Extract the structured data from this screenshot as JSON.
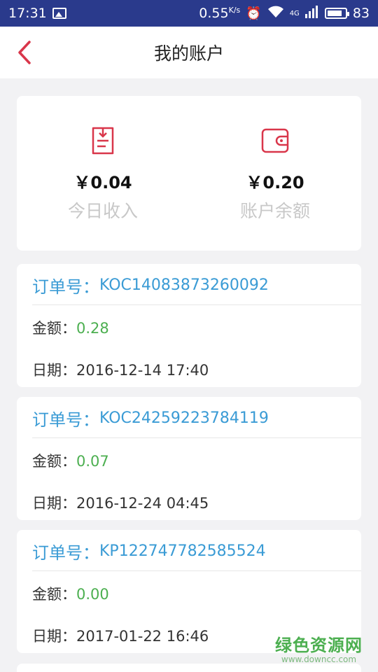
{
  "status_bar": {
    "time": "17:31",
    "speed": "0.55",
    "speed_unit": "K/s",
    "network": "4G",
    "battery": "83",
    "battery_level": 0.83
  },
  "nav": {
    "title": "我的账户"
  },
  "summary": {
    "today_income_amount": "￥0.04",
    "today_income_label": "今日收入",
    "balance_amount": "￥0.20",
    "balance_label": "账户余额"
  },
  "orders": [
    {
      "order_label": "订单号：",
      "order_no": "KOC14083873260092",
      "amount_label": "金额：",
      "amount": "0.28",
      "date_label": "日期：",
      "date": "2016-12-14 17:40"
    },
    {
      "order_label": "订单号：",
      "order_no": "KOC24259223784119",
      "amount_label": "金额：",
      "amount": "0.07",
      "date_label": "日期：",
      "date": "2016-12-24 04:45"
    },
    {
      "order_label": "订单号：",
      "order_no": "KP122747782585524",
      "amount_label": "金额：",
      "amount": "0.00",
      "date_label": "日期：",
      "date": "2017-01-22 16:46"
    }
  ],
  "watermark": {
    "main": "绿色资源网",
    "sub": "www.downcc.com"
  },
  "colors": {
    "accent_red": "#d9364a",
    "order_blue": "#3a9bd5",
    "amount_green": "#4caf50",
    "status_bar": "#2a3a8c"
  }
}
